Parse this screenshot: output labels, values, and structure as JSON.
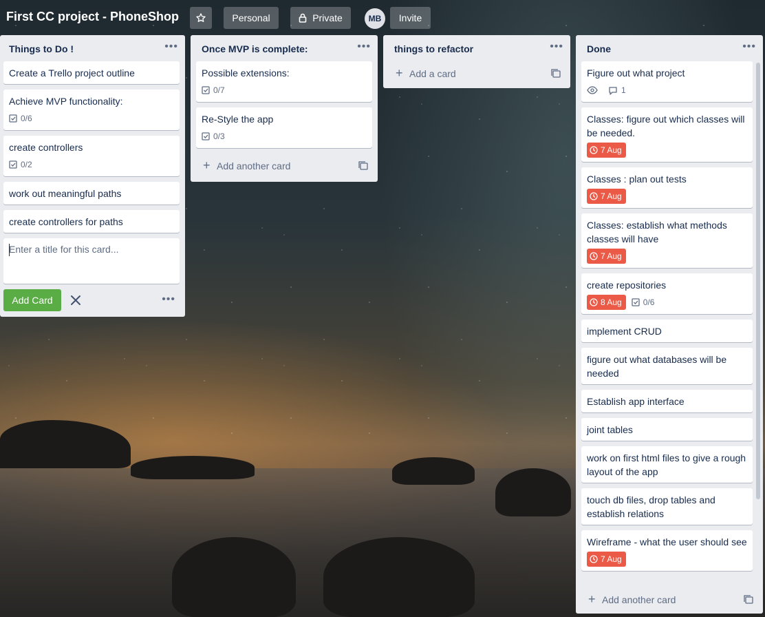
{
  "board": {
    "title": "First CC project - PhoneShop",
    "workspace_label": "Personal",
    "visibility_label": "Private",
    "member_initials": "MB",
    "invite_label": "Invite"
  },
  "lists": [
    {
      "title": "Things to Do !",
      "cards": [
        {
          "title": "Create a Trello project outline"
        },
        {
          "title": "Achieve MVP functionality:",
          "checklist": "0/6"
        },
        {
          "title": "create controllers",
          "checklist": "0/2"
        },
        {
          "title": "work out meaningful paths"
        },
        {
          "title": "create controllers for paths"
        }
      ],
      "composer": {
        "placeholder": "Enter a title for this card...",
        "add_button": "Add Card"
      }
    },
    {
      "title": "Once MVP is complete:",
      "cards": [
        {
          "title": "Possible extensions:",
          "checklist": "0/7"
        },
        {
          "title": "Re-Style the app",
          "checklist": "0/3"
        }
      ],
      "add_label": "Add another card"
    },
    {
      "title": "things to refactor",
      "cards": [],
      "add_label": "Add a card"
    },
    {
      "title": "Done",
      "cards": [
        {
          "title": "Figure out what project",
          "comments": "1"
        },
        {
          "title": "Classes: figure out which classes will be needed.",
          "due": "7 Aug"
        },
        {
          "title": "Classes : plan out tests",
          "due": "7 Aug"
        },
        {
          "title": "Classes: establish what methods classes will have",
          "due": "7 Aug"
        },
        {
          "title": "create repositories",
          "due": "8 Aug",
          "checklist": "0/6"
        },
        {
          "title": "implement CRUD"
        },
        {
          "title": "figure out what databases will be needed"
        },
        {
          "title": "Establish app interface"
        },
        {
          "title": "joint tables"
        },
        {
          "title": "work on first html files to give a rough layout of the app"
        },
        {
          "title": "touch db files, drop tables and establish relations"
        },
        {
          "title": "Wireframe - what the user should see",
          "due": "7 Aug"
        }
      ],
      "add_label": "Add another card"
    }
  ],
  "colors": {
    "list_bg": "#ebecf0",
    "due_overdue": "#eb5a46",
    "add_button": "#5aac44"
  }
}
